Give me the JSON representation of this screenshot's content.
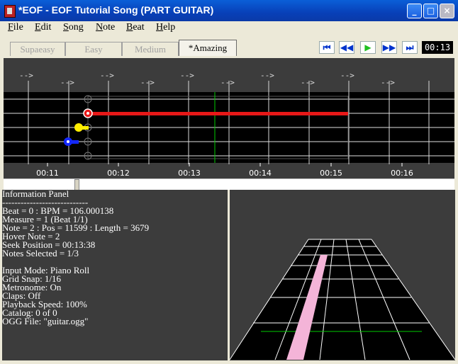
{
  "window": {
    "title": "*EOF - EOF Tutorial Song (PART GUITAR)",
    "minimize": "_",
    "maximize": "□",
    "close": "×"
  },
  "menu": [
    "File",
    "Edit",
    "Song",
    "Note",
    "Beat",
    "Help"
  ],
  "difficulty_tabs": [
    {
      "label": "Supaeasy",
      "active": false
    },
    {
      "label": "Easy",
      "active": false
    },
    {
      "label": "Medium",
      "active": false
    },
    {
      "label": "*Amazing",
      "active": true
    }
  ],
  "transport": {
    "rewind": "⏮",
    "back": "◀◀",
    "play": "▶",
    "forward": "▶▶",
    "end": "⏭",
    "time": "00:13"
  },
  "editor": {
    "beat_markers": [
      "-->",
      "-->",
      "-->",
      "-->",
      "-->",
      "-->",
      "-->",
      "-->",
      "-->",
      "-->"
    ],
    "time_labels": [
      "00:11",
      "00:12",
      "00:13",
      "00:14",
      "00:15",
      "00:16"
    ],
    "colors": {
      "red": "#e81818",
      "yellow": "#ffee00",
      "blue": "#1428ff",
      "seek": "#00cc00"
    }
  },
  "info_panel": {
    "lines": [
      "Information Panel",
      "----------------------------",
      "Beat = 0 : BPM = 106.000138",
      "Measure = 1 (Beat 1/1)",
      "Note = 2 : Pos = 11599 : Length = 3679",
      "Hover Note = 2",
      "Seek Position = 00:13:38",
      "Notes Selected = 1/3",
      "",
      "Input Mode: Piano Roll",
      "Grid Snap: 1/16",
      "Metronome: On",
      "Claps: Off",
      "Playback Speed: 100%",
      "Catalog: 0 of 0",
      "OGG File: \"guitar.ogg\""
    ]
  },
  "preview": {
    "highway_color": "#000000",
    "note_color": "#f4b4d8",
    "line_color": "#00cc00"
  }
}
